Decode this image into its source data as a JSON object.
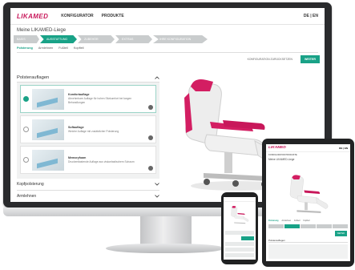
{
  "desktop": {
    "logo": "LIKAMED",
    "nav": [
      "KONFIGURATOR",
      "PRODUKTE"
    ],
    "lang": "DE | EN",
    "title": "Meine LIKAMED-Liege",
    "steps": [
      "BASIS",
      "AUSSTATTUNG",
      "ZUBEHÖR",
      "EXTRAS",
      "IHRE KONFIGURATION"
    ],
    "active_step": 1,
    "subtabs": [
      "Polsterung",
      "Armlehnen",
      "Fußteil",
      "Kopfteil"
    ],
    "active_subtab": 0,
    "link_button": "KONFIGURATION ZURÜCKSETZEN",
    "next_button": "WEITER",
    "panel_title": "Polsterauflagen",
    "options": [
      {
        "title": "Komfortauflage",
        "desc": "Abnehmbare Auflage für hohen Sitzkomfort bei langen Behandlungen",
        "selected": true
      },
      {
        "title": "Softauflage",
        "desc": "Weiche Auflage mit zusätzlicher Polsterung",
        "selected": false
      },
      {
        "title": "Memoryfoam",
        "desc": "Druckentlastende Auflage aus viskoelastischem Schaum",
        "selected": false
      }
    ],
    "sections": [
      "Kopfpolsterung",
      "Armlehnen"
    ]
  },
  "tablet": {
    "logo": "LIKAMED",
    "lang": "DE | EN",
    "nav": "KONFIGURATOR  PRODUKTE",
    "title": "Meine LIKAMED-Liege",
    "tabs": [
      "Polsterung",
      "Armlehnen",
      "Fußteil",
      "Kopfteil"
    ],
    "button": "WEITER",
    "panel_title": "Polsterauflagen"
  },
  "colors": {
    "accent": "#19a287",
    "brand": "#c8175a",
    "device": "#2a2b2d"
  },
  "icons": {
    "chevron_up": "chevron-up-icon",
    "chevron_down": "chevron-down-icon"
  }
}
